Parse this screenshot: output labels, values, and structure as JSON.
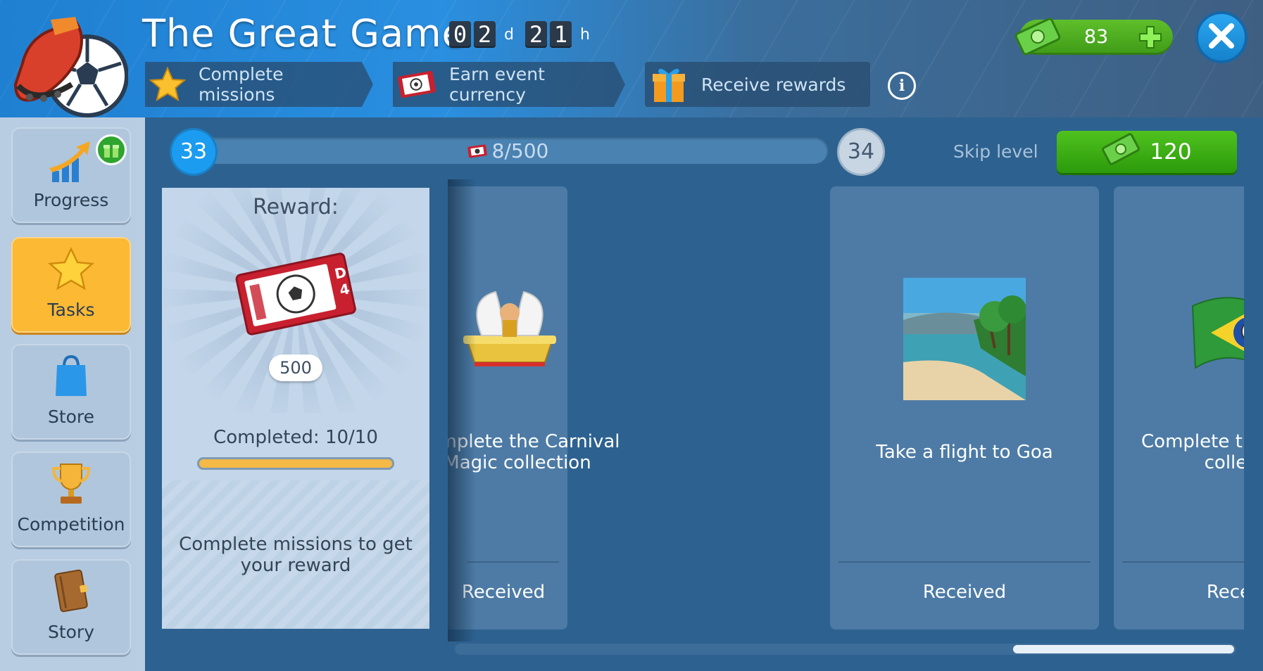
{
  "header": {
    "title": "The Great Game",
    "timer": {
      "days": [
        "0",
        "2"
      ],
      "day_unit": "d",
      "hours": [
        "2",
        "1"
      ],
      "hour_unit": "h"
    },
    "steps": [
      {
        "label": "Complete missions",
        "icon": "star-icon"
      },
      {
        "label": "Earn event currency",
        "icon": "ticket-icon"
      },
      {
        "label": "Receive rewards",
        "icon": "gift-icon"
      }
    ],
    "info_icon": "info-icon",
    "currency": {
      "amount": "83",
      "icon": "cash-icon",
      "plus_icon": "plus-icon"
    },
    "close_icon": "close-icon"
  },
  "sidebar": {
    "items": [
      {
        "label": "Progress",
        "icon": "progress-chart-icon",
        "badge_icon": "gift-badge-icon",
        "active": false
      },
      {
        "label": "Tasks",
        "icon": "star-icon",
        "active": true
      },
      {
        "label": "Store",
        "icon": "shopping-bag-icon",
        "active": false
      },
      {
        "label": "Competition",
        "icon": "trophy-icon",
        "active": false
      },
      {
        "label": "Story",
        "icon": "book-icon",
        "active": false
      }
    ]
  },
  "progress": {
    "current_level": "33",
    "next_level": "34",
    "text": "8/500",
    "fill_fraction": 0.016,
    "skip_label": "Skip level",
    "skip_price": "120"
  },
  "reward": {
    "title": "Reward:",
    "count": "500",
    "completed": "Completed: 10/10",
    "completed_fraction": 1.0,
    "footer": "Complete missions to get your reward"
  },
  "cards": [
    {
      "desc": "Complete the Carnival Magic collection",
      "status": "Received",
      "image": "carnival-float-image"
    },
    {
      "desc": "Take a flight to Goa",
      "status": "Received",
      "image": "goa-beach-image"
    },
    {
      "desc": "Complete the Fan Zone collection",
      "status": "Received",
      "image": "brazil-flag-image"
    }
  ],
  "colors": {
    "accent_yellow": "#fbb934",
    "accent_green": "#3fae14",
    "accent_blue": "#1b9cf0"
  }
}
